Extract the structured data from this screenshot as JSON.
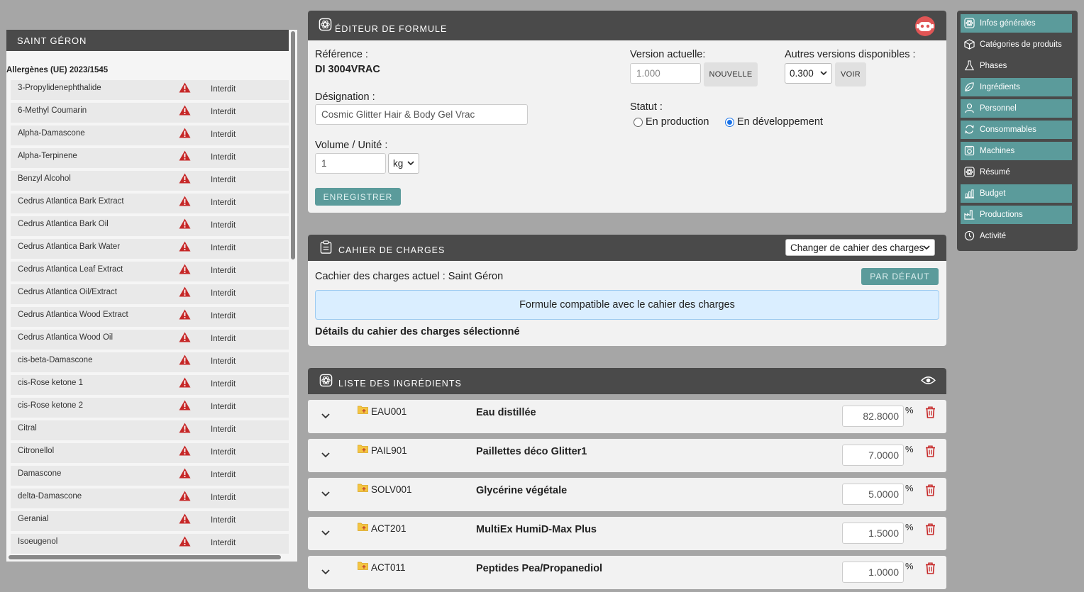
{
  "left_panel": {
    "title": "SAINT GÉRON",
    "subtitle": "Allergènes (UE) 2023/1545",
    "allergens": [
      {
        "name": "3-Propylidenephthalide",
        "status": "Interdit"
      },
      {
        "name": "6-Methyl Coumarin",
        "status": "Interdit"
      },
      {
        "name": "Alpha-Damascone",
        "status": "Interdit"
      },
      {
        "name": "Alpha-Terpinene",
        "status": "Interdit"
      },
      {
        "name": "Benzyl Alcohol",
        "status": "Interdit"
      },
      {
        "name": "Cedrus Atlantica Bark Extract",
        "status": "Interdit"
      },
      {
        "name": "Cedrus Atlantica Bark Oil",
        "status": "Interdit"
      },
      {
        "name": "Cedrus Atlantica Bark Water",
        "status": "Interdit"
      },
      {
        "name": "Cedrus Atlantica Leaf Extract",
        "status": "Interdit"
      },
      {
        "name": "Cedrus Atlantica Oil/Extract",
        "status": "Interdit"
      },
      {
        "name": "Cedrus Atlantica Wood Extract",
        "status": "Interdit"
      },
      {
        "name": "Cedrus Atlantica Wood Oil",
        "status": "Interdit"
      },
      {
        "name": "cis-beta-Damascone",
        "status": "Interdit"
      },
      {
        "name": "cis-Rose ketone 1",
        "status": "Interdit"
      },
      {
        "name": "cis-Rose ketone 2",
        "status": "Interdit"
      },
      {
        "name": "Citral",
        "status": "Interdit"
      },
      {
        "name": "Citronellol",
        "status": "Interdit"
      },
      {
        "name": "Damascone",
        "status": "Interdit"
      },
      {
        "name": "delta-Damascone",
        "status": "Interdit"
      },
      {
        "name": "Geranial",
        "status": "Interdit"
      },
      {
        "name": "Isoeugenol",
        "status": "Interdit"
      }
    ]
  },
  "editor": {
    "title": "ÉDITEUR DE FORMULE",
    "reference_label": "Référence :",
    "reference_value": "DI 3004VRAC",
    "designation_label": "Désignation :",
    "designation_value": "Cosmic Glitter Hair & Body Gel Vrac",
    "volume_label": "Volume / Unité :",
    "volume_value": "1",
    "unit_value": "kg",
    "save_label": "ENREGISTRER",
    "version_label": "Version actuelle:",
    "version_value": "1.000",
    "new_label": "NOUVELLE",
    "other_versions_label": "Autres versions disponibles :",
    "other_version_value": "0.300",
    "view_label": "VOIR",
    "status_label": "Statut :",
    "status_production": "En production",
    "status_development": "En développement",
    "status_selected": "En développement"
  },
  "specs": {
    "title": "CAHIER DE CHARGES",
    "change_label": "Changer de cahier des charges",
    "current_label": "Cachier des charges actuel : Saint Géron",
    "default_label": "PAR DÉFAUT",
    "alert": "Formule compatible avec le cahier des charges",
    "details_label": "Détails du cahier des charges sélectionné"
  },
  "ingredients": {
    "title": "LISTE DES INGRÉDIENTS",
    "percent_symbol": "%",
    "items": [
      {
        "code": "EAU001",
        "name": "Eau distillée",
        "percent": "82.8000"
      },
      {
        "code": "PAIL901",
        "name": "Paillettes déco Glitter1",
        "percent": "7.0000"
      },
      {
        "code": "SOLV001",
        "name": "Glycérine végétale",
        "percent": "5.0000"
      },
      {
        "code": "ACT201",
        "name": "MultiEx HumiD-Max Plus",
        "percent": "1.5000"
      },
      {
        "code": "ACT011",
        "name": "Peptides Pea/Propanediol",
        "percent": "1.0000"
      }
    ]
  },
  "nav": {
    "items": [
      {
        "label": "Infos générales",
        "icon": "formula-icon"
      },
      {
        "label": "Catégories de produits",
        "icon": "box-icon"
      },
      {
        "label": "Phases",
        "icon": "flask-icon"
      },
      {
        "label": "Ingrédients",
        "icon": "leaf-icon"
      },
      {
        "label": "Personnel",
        "icon": "person-icon"
      },
      {
        "label": "Consommables",
        "icon": "recycle-icon"
      },
      {
        "label": "Machines",
        "icon": "machine-icon"
      },
      {
        "label": "Résumé",
        "icon": "formula-icon"
      },
      {
        "label": "Budget",
        "icon": "chart-icon"
      },
      {
        "label": "Productions",
        "icon": "factory-icon"
      },
      {
        "label": "Activité",
        "icon": "clock-icon"
      }
    ]
  },
  "colors": {
    "header": "#4a4a4a",
    "teal": "#5b9b9b",
    "danger": "#c62828",
    "info_bg": "#daeeff"
  }
}
